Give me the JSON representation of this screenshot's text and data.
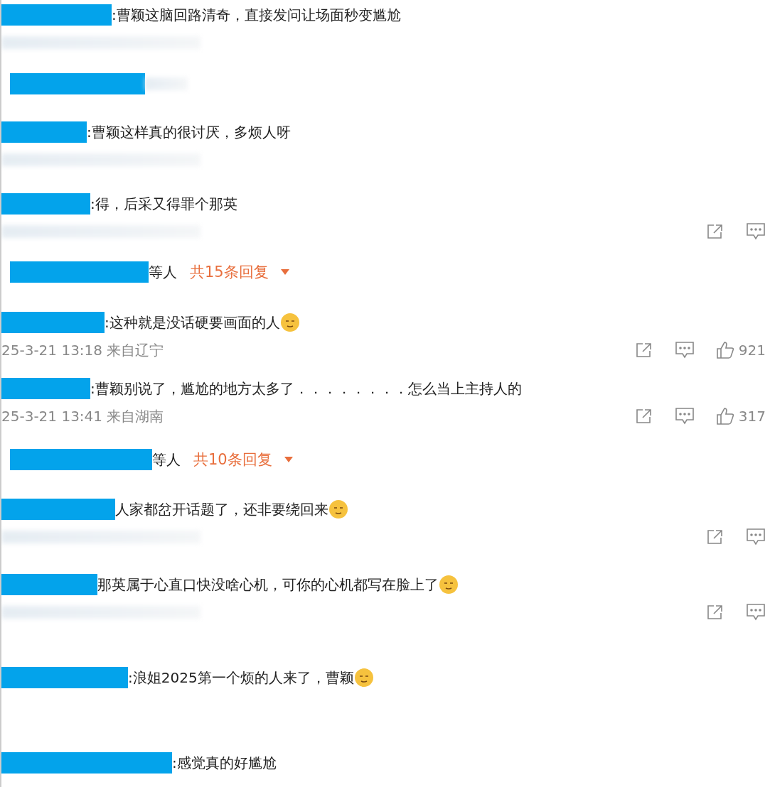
{
  "items": [
    {
      "kind": "comment",
      "text": ":曹颖这脑回路清奇，直接发问让场面秒变尴尬",
      "emoji": false,
      "meta_blurred": true,
      "actions": false
    },
    {
      "kind": "replies"
    },
    {
      "kind": "comment",
      "text": ":曹颖这样真的很讨厌，多烦人呀",
      "emoji": false,
      "meta_blurred": true,
      "actions": false
    },
    {
      "kind": "comment",
      "text": ":得，后采又得罪个那英",
      "emoji": false,
      "meta_blurred": true,
      "actions": true
    },
    {
      "kind": "replies",
      "suffix": "等人",
      "count": "共15条回复"
    },
    {
      "kind": "comment",
      "text": ":这种就是没话硬要画面的人",
      "emoji": true,
      "meta": "25-3-21 13:18 来自辽宁",
      "actions": true,
      "likes": "921"
    },
    {
      "kind": "comment",
      "text": ":曹颖别说了，尴尬的地方太多了．．．．．．．．怎么当上主持人的",
      "emoji": false,
      "meta": "25-3-21 13:41 来自湖南",
      "actions": true,
      "likes": "317"
    },
    {
      "kind": "replies",
      "suffix": "等人",
      "count": "共10条回复"
    },
    {
      "kind": "comment",
      "text": "人家都岔开话题了，还非要绕回来",
      "emoji": true,
      "meta_blurred": true,
      "actions": true
    },
    {
      "kind": "comment",
      "text": "那英属于心直口快没啥心机，可你的心机都写在脸上了",
      "emoji": true,
      "meta_blurred": true,
      "actions": true
    },
    {
      "kind": "comment",
      "text": ":浪姐2025第一个烦的人来了，曹颖",
      "emoji": true,
      "meta_blurred": false,
      "actions": false
    },
    {
      "kind": "comment",
      "text": ":感觉真的好尴尬",
      "emoji": false,
      "meta_blurred": false,
      "actions": false
    }
  ]
}
